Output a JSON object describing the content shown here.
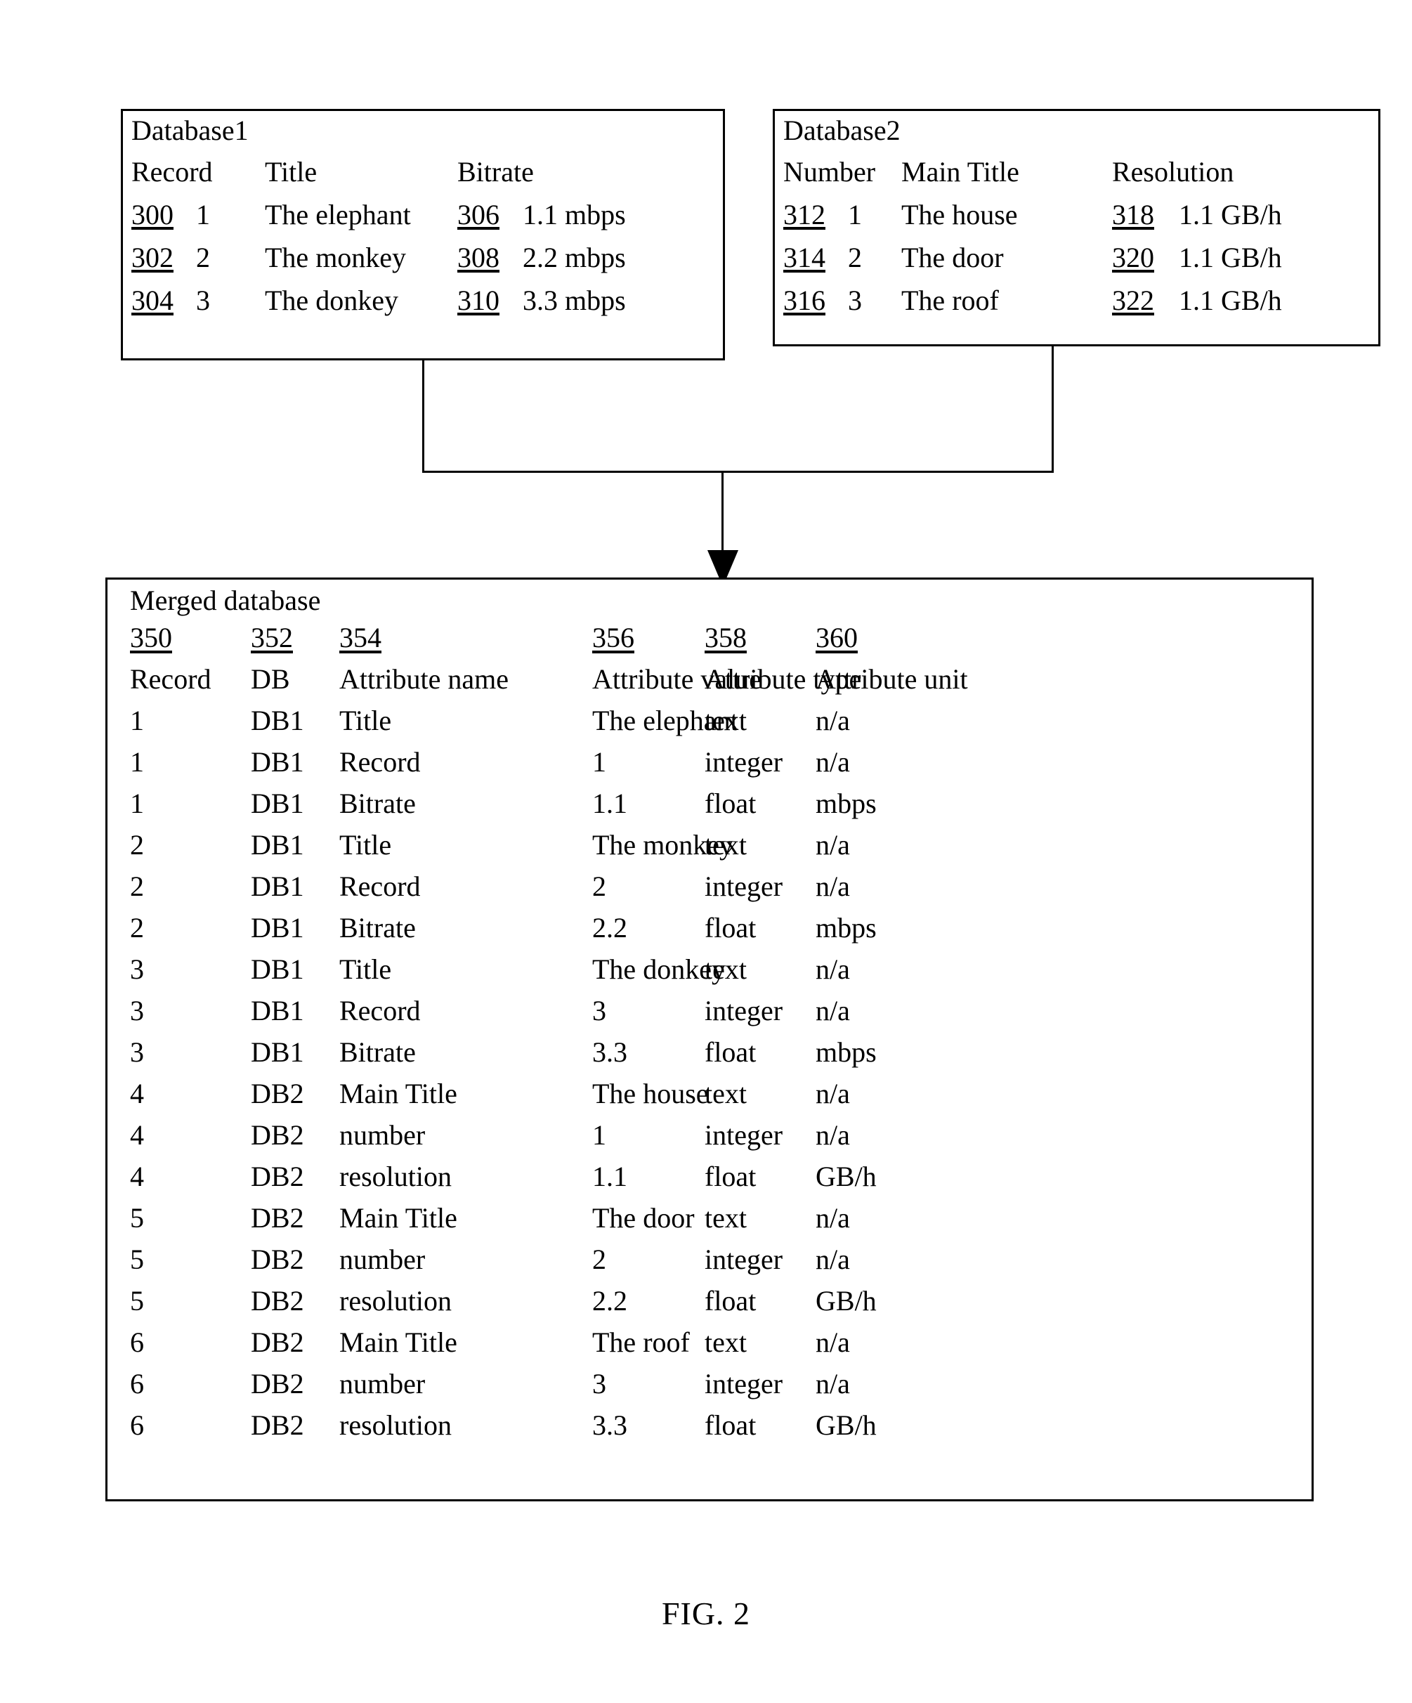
{
  "figure": {
    "caption": "FIG. 2"
  },
  "db1": {
    "title": "Database1",
    "headers": [
      "Record",
      "Title",
      "Bitrate"
    ],
    "rows": [
      {
        "ref_record": "300",
        "record": "1",
        "title": "The elephant",
        "ref_bitrate": "306",
        "bitrate": "1.1 mbps"
      },
      {
        "ref_record": "302",
        "record": "2",
        "title": "The monkey",
        "ref_bitrate": "308",
        "bitrate": "2.2 mbps"
      },
      {
        "ref_record": "304",
        "record": "3",
        "title": "The donkey",
        "ref_bitrate": "310",
        "bitrate": "3.3 mbps"
      }
    ]
  },
  "db2": {
    "title": "Database2",
    "headers": [
      "Number",
      "Main Title",
      "Resolution"
    ],
    "rows": [
      {
        "ref_number": "312",
        "number": "1",
        "title": "The house",
        "ref_resolution": "318",
        "resolution": "1.1 GB/h"
      },
      {
        "ref_number": "314",
        "number": "2",
        "title": "The door",
        "ref_resolution": "320",
        "resolution": "1.1 GB/h"
      },
      {
        "ref_number": "316",
        "number": "3",
        "title": "The roof",
        "ref_resolution": "322",
        "resolution": "1.1 GB/h"
      }
    ]
  },
  "merged": {
    "title": "Merged database",
    "refs": [
      "350",
      "352",
      "354",
      "356",
      "358",
      "360"
    ],
    "headers": [
      "Record",
      "DB",
      "Attribute name",
      "Attribute value",
      "Attribute type",
      "Attribute unit"
    ],
    "rows": [
      [
        "1",
        "DB1",
        "Title",
        "The elephant",
        "text",
        "n/a"
      ],
      [
        "1",
        "DB1",
        "Record",
        "1",
        "integer",
        "n/a"
      ],
      [
        "1",
        "DB1",
        "Bitrate",
        "1.1",
        "float",
        "mbps"
      ],
      [
        "2",
        "DB1",
        "Title",
        "The monkey",
        "text",
        "n/a"
      ],
      [
        "2",
        "DB1",
        "Record",
        "2",
        "integer",
        "n/a"
      ],
      [
        "2",
        "DB1",
        "Bitrate",
        "2.2",
        "float",
        "mbps"
      ],
      [
        "3",
        "DB1",
        "Title",
        "The donkey",
        "text",
        "n/a"
      ],
      [
        "3",
        "DB1",
        "Record",
        "3",
        "integer",
        "n/a"
      ],
      [
        "3",
        "DB1",
        "Bitrate",
        "3.3",
        "float",
        "mbps"
      ],
      [
        "4",
        "DB2",
        "Main Title",
        "The house",
        "text",
        "n/a"
      ],
      [
        "4",
        "DB2",
        "number",
        "1",
        "integer",
        "n/a"
      ],
      [
        "4",
        "DB2",
        "resolution",
        "1.1",
        "float",
        "GB/h"
      ],
      [
        "5",
        "DB2",
        "Main Title",
        "The door",
        "text",
        "n/a"
      ],
      [
        "5",
        "DB2",
        "number",
        "2",
        "integer",
        "n/a"
      ],
      [
        "5",
        "DB2",
        "resolution",
        "2.2",
        "float",
        "GB/h"
      ],
      [
        "6",
        "DB2",
        "Main Title",
        "The roof",
        "text",
        "n/a"
      ],
      [
        "6",
        "DB2",
        "number",
        "3",
        "integer",
        "n/a"
      ],
      [
        "6",
        "DB2",
        "resolution",
        "3.3",
        "float",
        "GB/h"
      ]
    ]
  }
}
